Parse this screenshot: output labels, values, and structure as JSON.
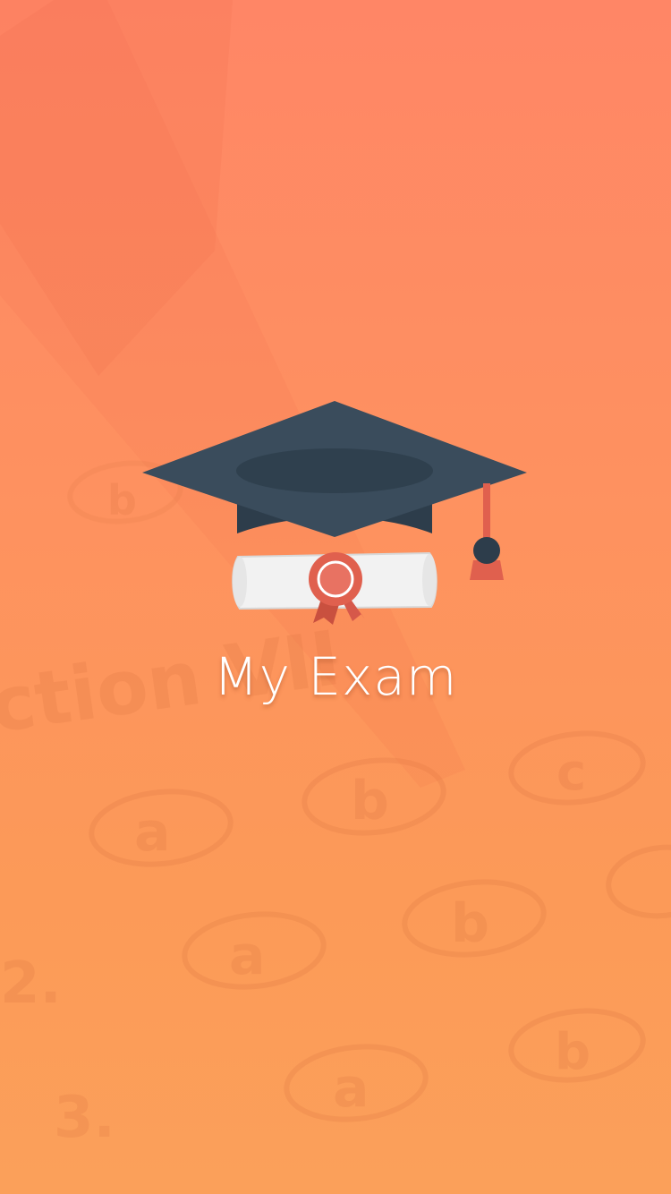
{
  "splash": {
    "app_name": "My Exam",
    "logo_icon": "graduation-cap-with-diploma-icon",
    "background": "faded answer sheet with bubbles a, b, c"
  },
  "colors": {
    "background_top": "#ff8666",
    "background_bottom": "#fba05a",
    "cap": "#3a4c5c",
    "diploma": "#f2f2f2",
    "ribbon": "#e0604e",
    "title_text": "#ffffff"
  }
}
